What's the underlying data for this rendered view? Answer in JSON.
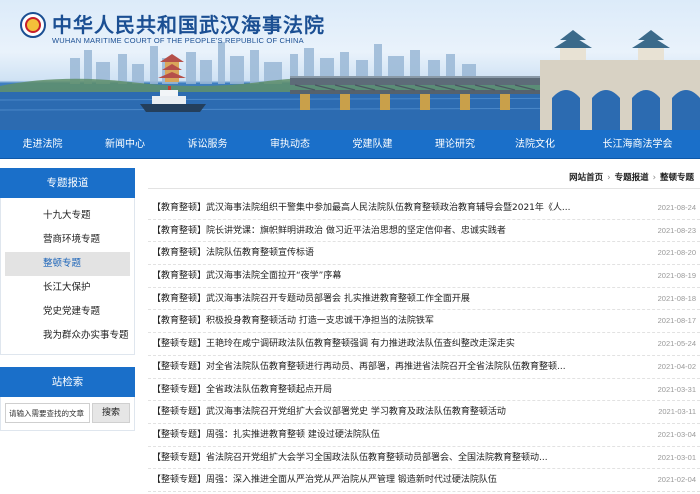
{
  "header": {
    "title": "中华人民共和国武汉海事法院",
    "subtitle": "WUHAN MARITIME COURT OF THE PEOPLE'S REPUBLIC OF CHINA",
    "logo_icon": "court-emblem-icon"
  },
  "nav": {
    "items": [
      "走进法院",
      "新闻中心",
      "诉讼服务",
      "审执动态",
      "党建队建",
      "理论研究",
      "法院文化",
      "长江海商法学会"
    ]
  },
  "sidebar": {
    "section_title": "专题报道",
    "items": [
      "十九大专题",
      "营商环境专题",
      "整顿专题",
      "长江大保护",
      "党史党建专题",
      "我为群众办实事专题"
    ],
    "active_index": 2,
    "search_title": "站检索",
    "search_placeholder": "请输入需要查找的文章",
    "search_button": "搜索"
  },
  "breadcrumb": {
    "items": [
      "网站首页",
      "专题报道",
      "整顿专题"
    ],
    "separator": "›"
  },
  "articles": [
    {
      "title": "【教育整顿】武汉海事法院组织干警集中参加最高人民法院队伍教育整顿政治教育辅导会暨2021年《人...",
      "date": "2021-08-24"
    },
    {
      "title": "【教育整顿】院长讲党课：旗帜鲜明讲政治 做习近平法治思想的坚定信仰者、忠诚实践者",
      "date": "2021-08-23"
    },
    {
      "title": "【教育整顿】法院队伍教育整顿宣传标语",
      "date": "2021-08-20"
    },
    {
      "title": "【教育整顿】武汉海事法院全面拉开“夜学”序幕",
      "date": "2021-08-19"
    },
    {
      "title": "【教育整顿】武汉海事法院召开专题动员部署会 扎实推进教育整顿工作全面开展",
      "date": "2021-08-18"
    },
    {
      "title": "【教育整顿】积极投身教育整顿活动 打造一支忠诚干净担当的法院铁军",
      "date": "2021-08-17"
    },
    {
      "title": "【整顿专题】王艳玲在咸宁调研政法队伍教育整顿强调 有力推进政法队伍查纠整改走深走实",
      "date": "2021-05-24"
    },
    {
      "title": "【整顿专题】对全省法院队伍教育整顿进行再动员、再部署，再推进省法院召开全省法院队伍教育整顿...",
      "date": "2021-04-02"
    },
    {
      "title": "【整顿专题】全省政法队伍教育整顿起点开局",
      "date": "2021-03-31"
    },
    {
      "title": "【整顿专题】武汉海事法院召开党组扩大会议部署党史 学习教育及政法队伍教育整顿活动",
      "date": "2021-03-11"
    },
    {
      "title": "【整顿专题】周强：扎实推进教育整顿 建设过硬法院队伍",
      "date": "2021-03-04"
    },
    {
      "title": "【整顿专题】省法院召开党组扩大会学习全国政法队伍教育整顿动员部署会、全国法院教育整顿动...",
      "date": "2021-03-01"
    },
    {
      "title": "【整顿专题】周强：深入推进全面从严治党从严治院从严管理 锻造新时代过硬法院队伍",
      "date": "2021-02-04"
    }
  ]
}
